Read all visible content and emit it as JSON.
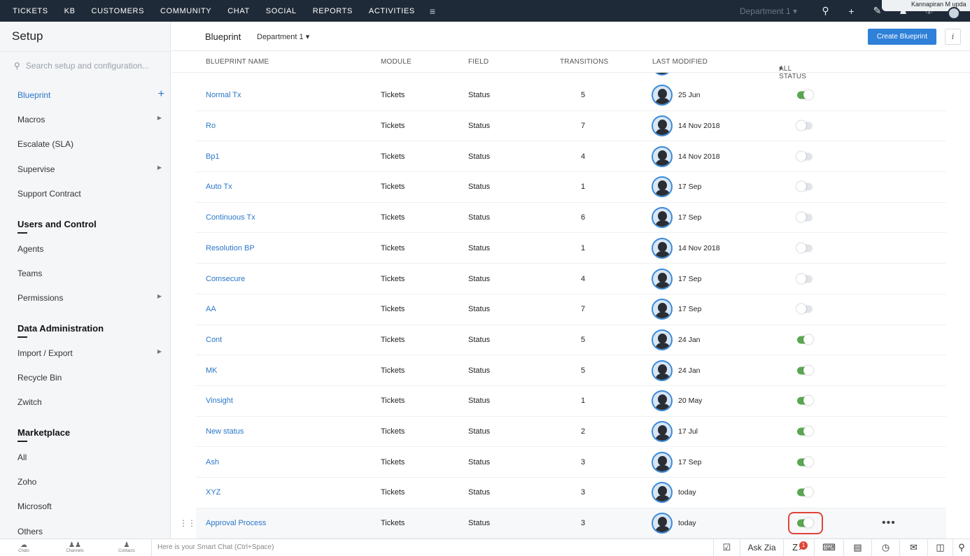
{
  "topnav": {
    "items": [
      "TICKETS",
      "KB",
      "CUSTOMERS",
      "COMMUNITY",
      "CHAT",
      "SOCIAL",
      "REPORTS",
      "ACTIVITIES"
    ],
    "menu_icon": "hamburger-icon",
    "department": "Department 1",
    "notification_text": "Kannapiran M upda"
  },
  "sidebar": {
    "title": "Setup",
    "search_placeholder": "Search setup and configuration...",
    "top_items": [
      "Blueprint",
      "Macros",
      "Escalate (SLA)",
      "Supervise",
      "Support Contract"
    ],
    "sections": [
      {
        "title": "Users and Control",
        "items": [
          "Agents",
          "Teams",
          "Permissions"
        ]
      },
      {
        "title": "Data Administration",
        "items": [
          "Import / Export",
          "Recycle Bin",
          "Zwitch"
        ]
      },
      {
        "title": "Marketplace",
        "items": [
          "All",
          "Zoho",
          "Microsoft",
          "Others"
        ]
      }
    ]
  },
  "header": {
    "title": "Blueprint",
    "department": "Department 1",
    "create_button": "Create Blueprint",
    "info_button": "i"
  },
  "table": {
    "columns": {
      "name": "BLUEPRINT NAME",
      "module": "MODULE",
      "field": "FIELD",
      "transitions": "TRANSITIONS",
      "last_modified": "LAST MODIFIED",
      "status": "ALL STATUS"
    },
    "rows": [
      {
        "name": "Normal Tx",
        "module": "Tickets",
        "field": "Status",
        "transitions": "5",
        "modified": "25 Jun",
        "enabled": true
      },
      {
        "name": "Ro",
        "module": "Tickets",
        "field": "Status",
        "transitions": "7",
        "modified": "14 Nov 2018",
        "enabled": false
      },
      {
        "name": "Bp1",
        "module": "Tickets",
        "field": "Status",
        "transitions": "4",
        "modified": "14 Nov 2018",
        "enabled": false
      },
      {
        "name": "Auto Tx",
        "module": "Tickets",
        "field": "Status",
        "transitions": "1",
        "modified": "17 Sep",
        "enabled": false
      },
      {
        "name": "Continuous Tx",
        "module": "Tickets",
        "field": "Status",
        "transitions": "6",
        "modified": "17 Sep",
        "enabled": false
      },
      {
        "name": "Resolution BP",
        "module": "Tickets",
        "field": "Status",
        "transitions": "1",
        "modified": "14 Nov 2018",
        "enabled": false
      },
      {
        "name": "Comsecure",
        "module": "Tickets",
        "field": "Status",
        "transitions": "4",
        "modified": "17 Sep",
        "enabled": false
      },
      {
        "name": "AA",
        "module": "Tickets",
        "field": "Status",
        "transitions": "7",
        "modified": "17 Sep",
        "enabled": false
      },
      {
        "name": "Cont",
        "module": "Tickets",
        "field": "Status",
        "transitions": "5",
        "modified": "24 Jan",
        "enabled": true
      },
      {
        "name": "MK",
        "module": "Tickets",
        "field": "Status",
        "transitions": "5",
        "modified": "24 Jan",
        "enabled": true
      },
      {
        "name": "Vinsight",
        "module": "Tickets",
        "field": "Status",
        "transitions": "1",
        "modified": "20 May",
        "enabled": true
      },
      {
        "name": "New status",
        "module": "Tickets",
        "field": "Status",
        "transitions": "2",
        "modified": "17 Jul",
        "enabled": true
      },
      {
        "name": "Ash",
        "module": "Tickets",
        "field": "Status",
        "transitions": "3",
        "modified": "17 Sep",
        "enabled": true
      },
      {
        "name": "XYZ",
        "module": "Tickets",
        "field": "Status",
        "transitions": "3",
        "modified": "today",
        "enabled": true
      },
      {
        "name": "Approval Process",
        "module": "Tickets",
        "field": "Status",
        "transitions": "3",
        "modified": "today",
        "enabled": true,
        "highlighted": true
      }
    ]
  },
  "bottombar": {
    "tabs": [
      "Chats",
      "Channels",
      "Contacts"
    ],
    "chat_placeholder": "Here is your Smart Chat (Ctrl+Space)",
    "ask_zia": "Ask Zia",
    "zia_badge": "1"
  },
  "colors": {
    "topnav_bg": "#1f2a38",
    "accent": "#2f80d8",
    "link": "#2a77c9",
    "toggle_on": "#5aa752",
    "highlight": "#e0443a"
  }
}
